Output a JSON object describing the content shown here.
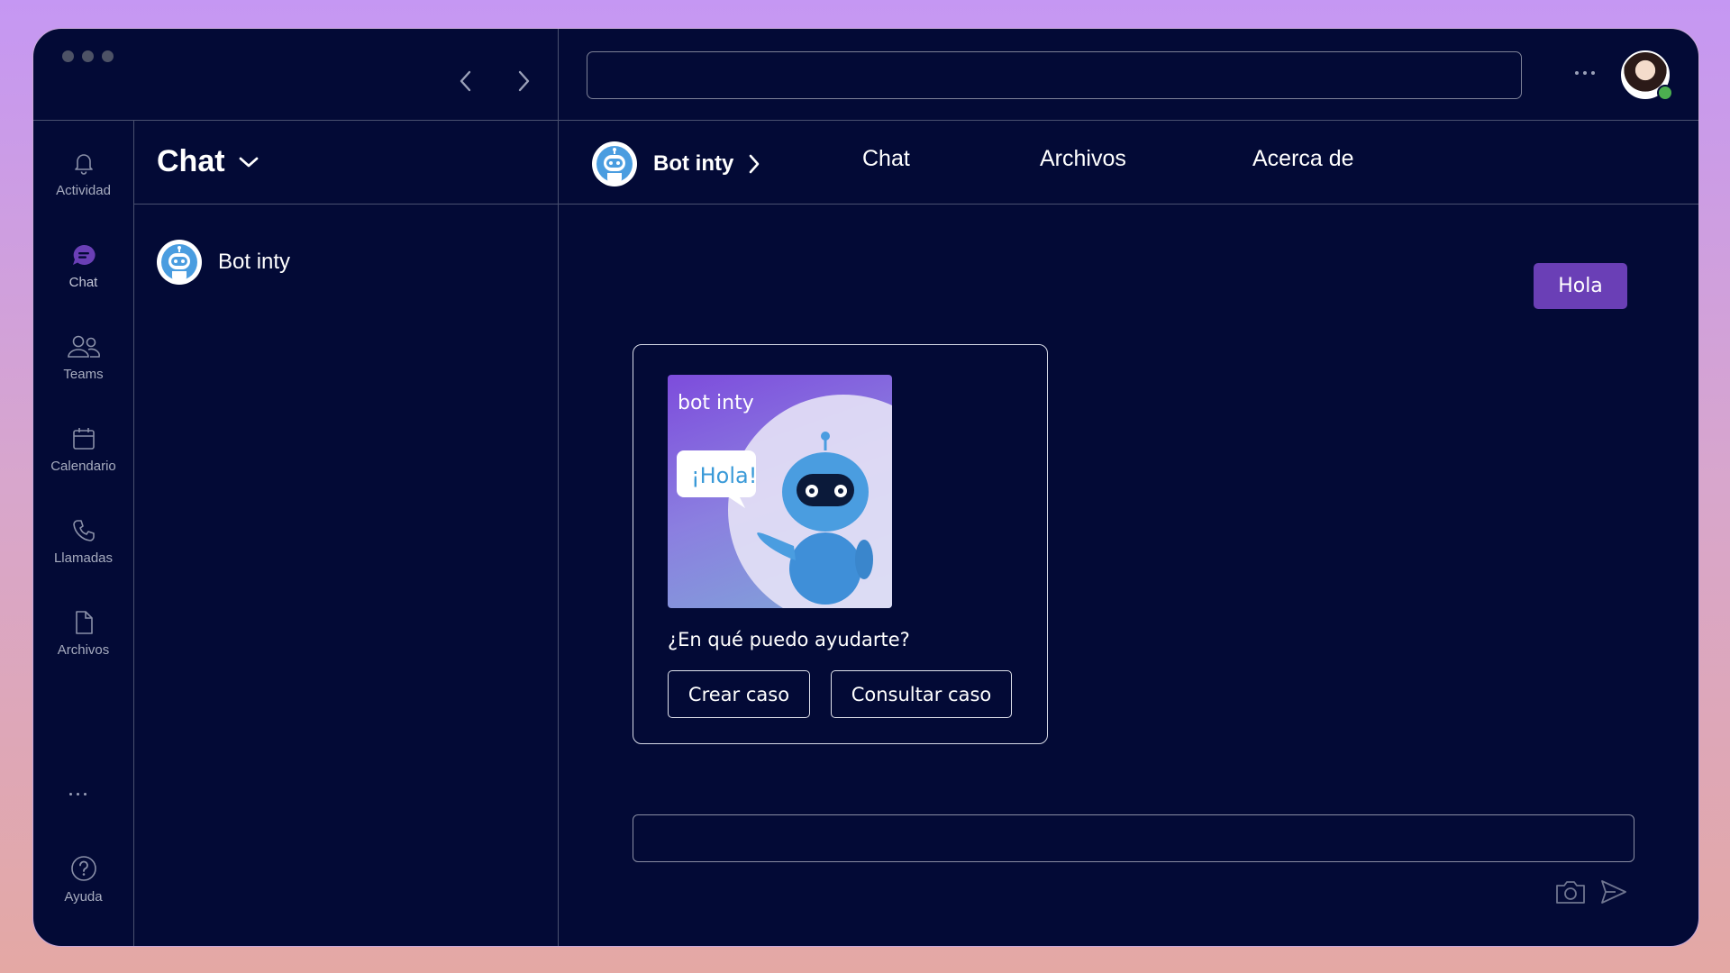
{
  "titlebar": {
    "search_placeholder": ""
  },
  "rail": {
    "items": [
      {
        "label": "Actividad",
        "icon": "bell-icon"
      },
      {
        "label": "Chat",
        "icon": "chat-icon"
      },
      {
        "label": "Teams",
        "icon": "teams-icon"
      },
      {
        "label": "Calendario",
        "icon": "calendar-icon"
      },
      {
        "label": "Llamadas",
        "icon": "phone-icon"
      },
      {
        "label": "Archivos",
        "icon": "file-icon"
      }
    ],
    "help": {
      "label": "Ayuda",
      "icon": "help-icon"
    }
  },
  "list": {
    "title": "Chat",
    "chats": [
      {
        "name": "Bot inty"
      }
    ]
  },
  "conversation": {
    "name": "Bot inty",
    "tabs": [
      "Chat",
      "Archivos",
      "Acerca de"
    ],
    "outgoing_message": "Hola",
    "card": {
      "image_brand": "bot inty",
      "image_bubble": "¡Hola!",
      "question": "¿En qué puedo ayudarte?",
      "buttons": [
        "Crear caso",
        "Consultar caso"
      ]
    },
    "composer_placeholder": ""
  },
  "colors": {
    "background": "#030a36",
    "accent": "#6a3fb6",
    "status_online": "#4caf50"
  }
}
